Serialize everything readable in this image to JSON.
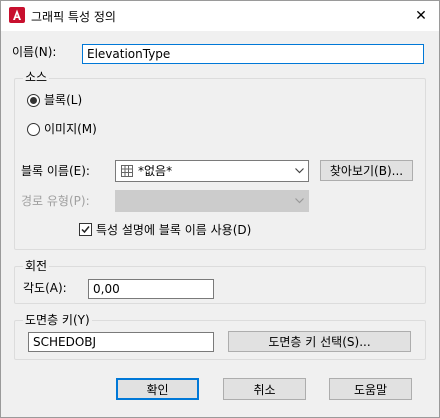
{
  "window": {
    "title": "그래픽 특성 정의",
    "close_glyph": "✕",
    "app_icon": "autocad-logo-icon"
  },
  "name_field": {
    "label": "이름(N):",
    "value": "ElevationType"
  },
  "source_group": {
    "title": "소스",
    "radio_block": {
      "label": "블록(L)",
      "selected": true
    },
    "radio_image": {
      "label": "이미지(M)",
      "selected": false
    },
    "block_name": {
      "label": "블록 이름(E):",
      "value": "*없음*",
      "icon": "block-icon"
    },
    "path_type": {
      "label": "경로 유형(P):",
      "value": "",
      "enabled": false
    },
    "use_block_name_checkbox": {
      "label": "특성 설명에 블록 이름 사용(D)",
      "checked": true
    },
    "browse_button": "찾아보기(B)..."
  },
  "rotation_group": {
    "title": "회전",
    "angle_label": "각도(A):",
    "angle_value": "0,00"
  },
  "layer_key_group": {
    "title": "도면층 키(Y)",
    "value": "SCHEDOBJ",
    "select_button": "도면층 키 선택(S)..."
  },
  "buttons": {
    "ok": "확인",
    "cancel": "취소",
    "help": "도움말"
  },
  "colors": {
    "accent": "#0078d7",
    "autocad_red": "#c8102e",
    "dialog_bg": "#f0f0f0"
  }
}
